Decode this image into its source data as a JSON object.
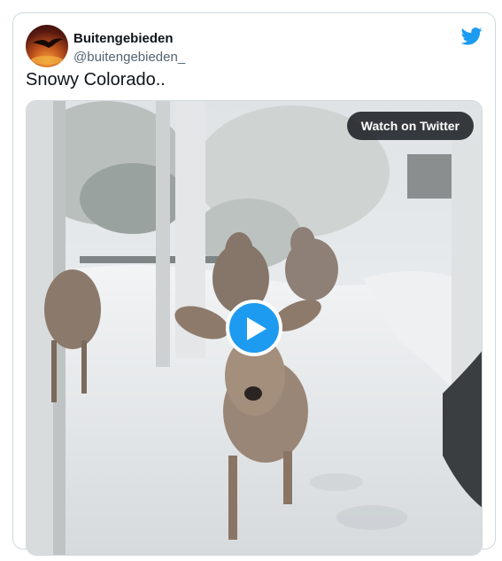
{
  "tweet": {
    "author_name": "Buitengebieden",
    "author_handle": "@buitengebieden_",
    "text": "Snowy Colorado.."
  },
  "media": {
    "watch_label": "Watch on Twitter",
    "play_icon": "play-icon"
  },
  "icons": {
    "brand": "twitter-bird-icon",
    "avatar": "avatar-eagle-sunset"
  },
  "colors": {
    "accent": "#1d9bf0",
    "text_primary": "#0f1419",
    "text_secondary": "#536471",
    "border": "#cfd9de"
  }
}
